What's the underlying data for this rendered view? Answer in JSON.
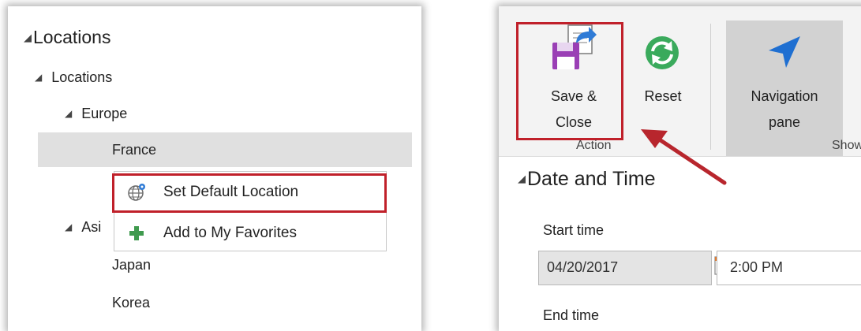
{
  "tree": {
    "root_label": "Locations",
    "nodes": [
      {
        "label": "Locations"
      },
      {
        "label": "Europe"
      },
      {
        "label": "France"
      },
      {
        "label": "Asi"
      },
      {
        "label": "Japan"
      },
      {
        "label": "Korea"
      }
    ]
  },
  "context_menu": {
    "items": [
      {
        "label": "Set Default Location",
        "icon": "globe-pin-icon"
      },
      {
        "label": "Add to My Favorites",
        "icon": "plus-icon"
      }
    ]
  },
  "ribbon": {
    "save_close_line1": "Save &",
    "save_close_line2": "Close",
    "reset_label": "Reset",
    "nav_line1": "Navigation",
    "nav_line2": "pane",
    "action_group": "Action",
    "show_group": "Show"
  },
  "form": {
    "section_title": "Date and Time",
    "start_label": "Start time",
    "start_date": "04/20/2017",
    "start_time": "2:00 PM",
    "end_label": "End time"
  },
  "colors": {
    "highlight_border": "#c0202a",
    "arrow": "#b8262d",
    "nav_arrow": "#1f6fd1",
    "reset_green": "#3aaa5c",
    "save_purple": "#9a3fb5",
    "plus_green": "#3f9a4e"
  }
}
